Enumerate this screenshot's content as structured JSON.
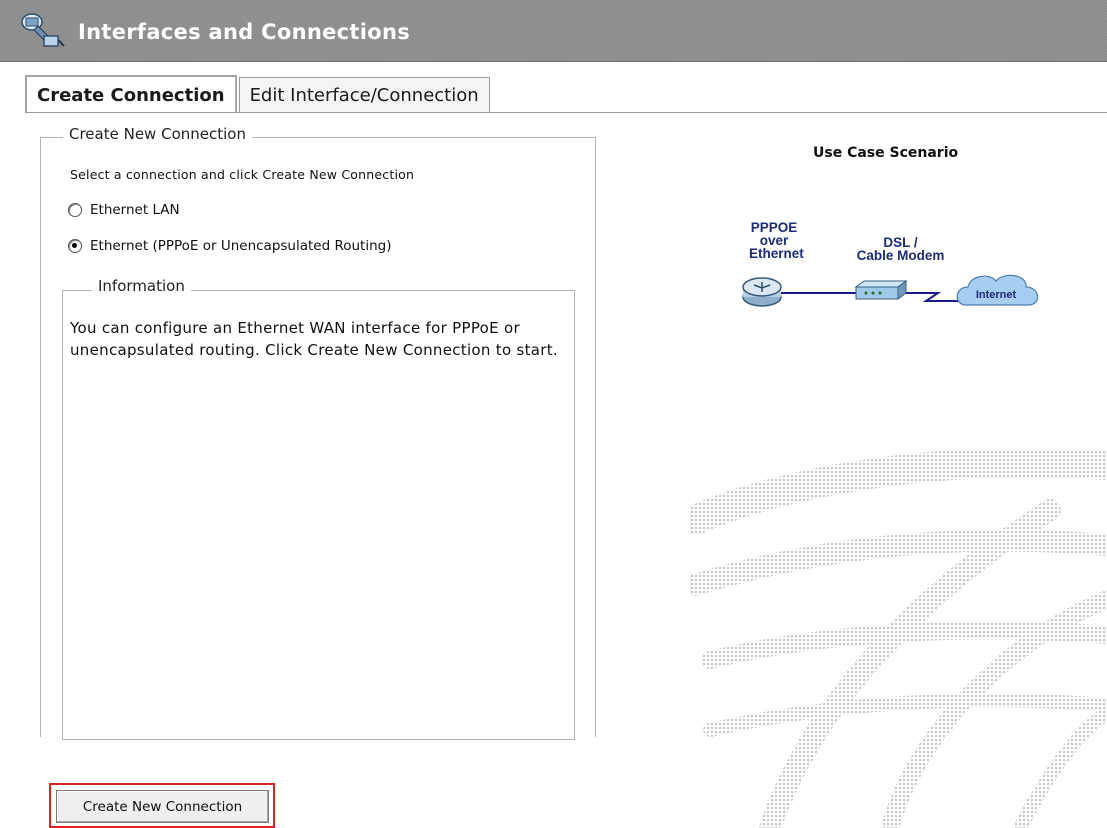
{
  "header": {
    "title": "Interfaces and Connections",
    "icon": "network-plug-icon"
  },
  "tabs": [
    {
      "label": "Create Connection",
      "active": true
    },
    {
      "label": "Edit Interface/Connection",
      "active": false
    }
  ],
  "create_panel": {
    "legend": "Create New Connection",
    "instruction": "Select a connection and click Create New Connection",
    "options": [
      {
        "label": "Ethernet LAN",
        "selected": false
      },
      {
        "label": "Ethernet (PPPoE or Unencapsulated Routing)",
        "selected": true
      }
    ],
    "info_legend": "Information",
    "info_text": "You can configure an Ethernet WAN interface for PPPoE or unencapsulated routing. Click Create New Connection to start.",
    "button_label": "Create New Connection"
  },
  "scenario": {
    "title": "Use Case Scenario",
    "router_label_1": "PPPOE",
    "router_label_2": "over",
    "router_label_3": "Ethernet",
    "modem_label_1": "DSL /",
    "modem_label_2": "Cable Modem",
    "cloud_label": "Internet"
  },
  "colors": {
    "titlebar": "#8f8f8f",
    "highlight": "#e02020",
    "diagram_text": "#1c2b7a"
  }
}
